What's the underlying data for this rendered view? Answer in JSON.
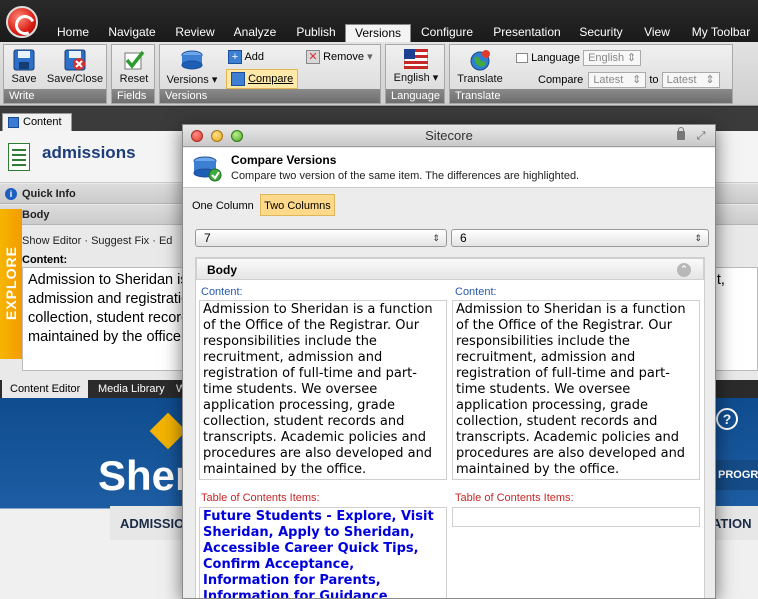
{
  "ribbon": {
    "tabs": [
      "Home",
      "Navigate",
      "Review",
      "Analyze",
      "Publish",
      "Versions",
      "Configure",
      "Presentation",
      "Security",
      "View",
      "My Toolbar"
    ],
    "active_tab": "Versions",
    "groups": {
      "write": {
        "label": "Write",
        "save": "Save",
        "save_close": "Save/Close"
      },
      "fields": {
        "label": "Fields",
        "reset": "Reset"
      },
      "versions": {
        "label": "Versions",
        "versions_btn": "Versions",
        "add": "Add",
        "remove": "Remove",
        "compare": "Compare"
      },
      "language": {
        "label": "Language",
        "english": "English"
      },
      "translate": {
        "label": "Translate",
        "translate_btn": "Translate",
        "language_label": "Language",
        "language_value": "English",
        "compare_label": "Compare",
        "compare_from": "Latest",
        "to_label": "to",
        "compare_to": "Latest"
      }
    }
  },
  "content_tab": "Content",
  "item": {
    "title": "admissions",
    "quick_info": "Quick Info",
    "section": "Body",
    "field_links": "Show Editor · Suggest Fix · Ed",
    "field_label": "Content:",
    "content_preview": "Admission to Sheridan is a function of the Office of the Registrar. Our responsibilities include the recruitment, admission and registration of full-time and part-time students. We oversee application processing, grade collection, student records and transcripts. Academic policies and procedures are also developed and maintained by the office."
  },
  "explore_label": "EXPLORE",
  "bottom_tabs": [
    "Content Editor",
    "Media Library",
    "W"
  ],
  "preview": {
    "logo_text": "Sher",
    "nav_admissions": "ADMISSIO",
    "progra": "PROGRA",
    "ation": "ATION",
    "help": "?"
  },
  "dialog": {
    "window_title": "Sitecore",
    "title": "Compare Versions",
    "subtitle": "Compare two version of the same item. The differences are highlighted.",
    "view_tabs": [
      "One Column",
      "Two Columns"
    ],
    "active_view": "Two Columns",
    "left_version": "7",
    "right_version": "6",
    "section": "Body",
    "content_label": "Content:",
    "toc_label": "Table of Contents Items:",
    "left_content": "Admission to Sheridan is a function of the Office of the Registrar. Our responsibilities include the recruitment, admission and registration of full-time and part-time students. We oversee application processing, grade collection, student records and transcripts. Academic policies and procedures are also developed and maintained by the office.",
    "right_content": "Admission to Sheridan is a function of the Office of the Registrar. Our responsibilities include the recruitment, admission and registration of full-time and part-time students. We oversee application processing, grade collection, student records and transcripts. Academic policies and procedures are also developed and maintained by the office.",
    "left_toc": "Future Students - Explore, Visit Sheridan, Apply to Sheridan, Accessible Career Quick Tips, Confirm Acceptance, Information for Parents, Information for Guidance Counsellors, Fees and",
    "right_toc": ""
  },
  "colors": {
    "ribbon_dark": "#1a1a1a",
    "active_compare": "#ffd98a",
    "toc_link": "#0000dd",
    "label_blue": "#2a5aa8",
    "label_red": "#c62828",
    "explore": "#f7b500",
    "site_blue": "#0f4c8f"
  }
}
